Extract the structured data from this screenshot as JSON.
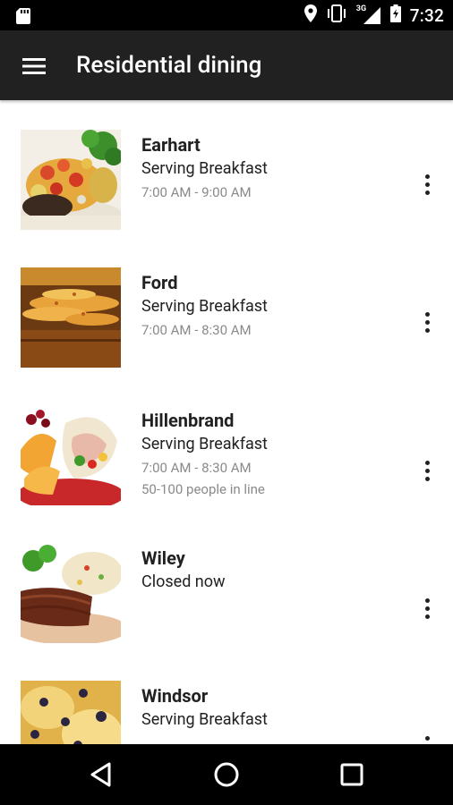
{
  "status_bar": {
    "time": "7:32",
    "network": "3G",
    "icons": [
      "sd-card-icon",
      "location-icon",
      "vibrate-icon",
      "signal-icon",
      "battery-icon"
    ]
  },
  "app_bar": {
    "title": "Residential dining",
    "menu_icon": "hamburger-menu-icon"
  },
  "dining_list": [
    {
      "name": "Earhart",
      "status": "Serving Breakfast",
      "hours": "7:00 AM - 9:00 AM",
      "line": ""
    },
    {
      "name": "Ford",
      "status": "Serving Breakfast",
      "hours": "7:00 AM - 8:30 AM",
      "line": ""
    },
    {
      "name": "Hillenbrand",
      "status": "Serving Breakfast",
      "hours": "7:00 AM - 8:30 AM",
      "line": "50-100 people in line"
    },
    {
      "name": "Wiley",
      "status": "Closed now",
      "hours": "",
      "line": ""
    },
    {
      "name": "Windsor",
      "status": "Serving Breakfast",
      "hours": "",
      "line": ""
    }
  ],
  "nav_bar": {
    "icons": [
      "back-icon",
      "home-icon",
      "recents-icon"
    ]
  }
}
